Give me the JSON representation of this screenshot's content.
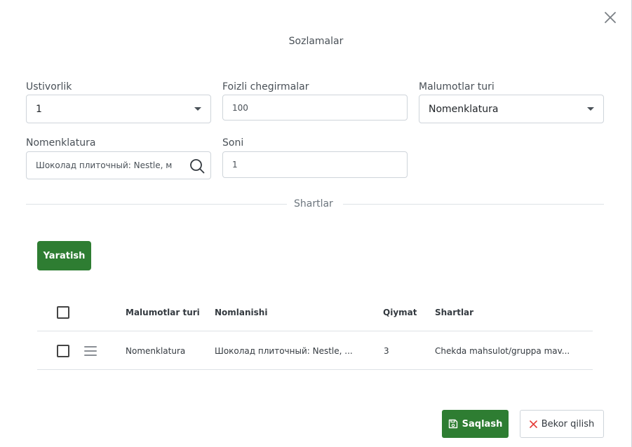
{
  "modal": {
    "title": "Sozlamalar"
  },
  "form": {
    "priority": {
      "label": "Ustivorlik",
      "value": "1"
    },
    "discount": {
      "label": "Foizli chegirmalar",
      "value": "100"
    },
    "data_type": {
      "label": "Malumotlar turi",
      "value": "Nomenklatura"
    },
    "nomenclature": {
      "label": "Nomenklatura",
      "value": "Шоколад плиточный: Nestle, м"
    },
    "count": {
      "label": "Soni",
      "value": "1"
    }
  },
  "conditions": {
    "section_label": "Shartlar",
    "create_label": "Yaratish",
    "columns": [
      "Malumotlar turi",
      "Nomlanishi",
      "Qiymat",
      "Shartlar"
    ],
    "rows": [
      {
        "data_type": "Nomenklatura",
        "name": "Шоколад плиточный: Nestle, ...",
        "value": "3",
        "condition": "Chekda mahsulot/gruppa mav..."
      }
    ]
  },
  "footer": {
    "save_label": "Saqlash",
    "cancel_label": "Bekor qilish"
  },
  "colors": {
    "primary": "#2e7d32",
    "cancel_icon": "#e53935"
  },
  "icons": {
    "close": "close-icon",
    "select": "chevron-down-icon",
    "search": "search-icon",
    "drag": "drag-handle-icon",
    "save": "save-icon",
    "cancel": "x-icon"
  }
}
